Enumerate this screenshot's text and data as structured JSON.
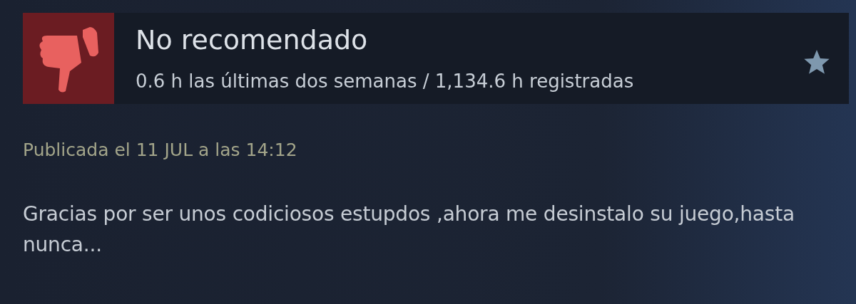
{
  "review": {
    "recommended": false,
    "verdict": "No recomendado",
    "hours": "0.6 h las últimas dos semanas / 1,134.6 h registradas",
    "posted": "Publicada el 11 JUL a las 14:12",
    "body": "Gracias por ser unos codiciosos estupdos ,ahora me desinstalo su juego,hasta nunca..."
  }
}
